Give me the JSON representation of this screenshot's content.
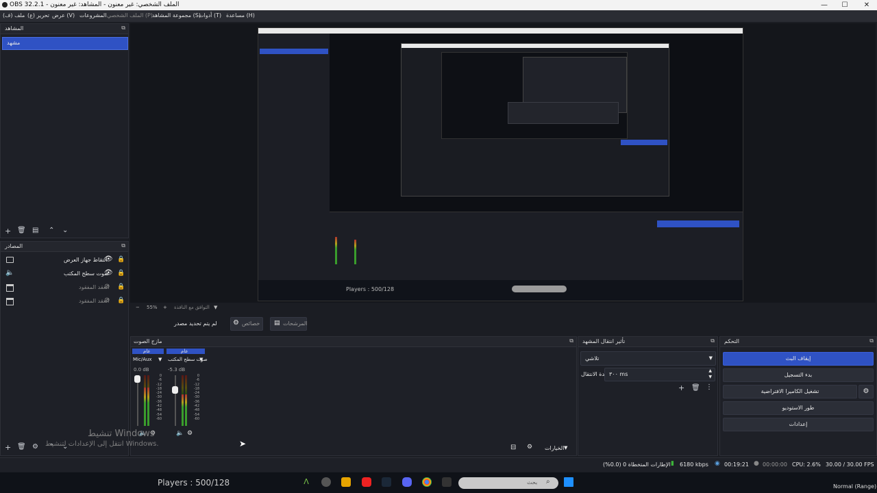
{
  "window": {
    "title": "OBS 32.2.1 - الملف الشخصي: غير معنون - المشاهد: غير معنون",
    "minimize": "—",
    "maximize": "☐",
    "close": "✕"
  },
  "menu": [
    "ملف (ف)",
    "تحرير (ع)",
    "عرض (V)",
    "الملف الشخصي (P)",
    "مجموعة المشاهد (S)",
    "أدوات (T)",
    "مساعدة (H)"
  ],
  "menu_extra": "المشروعات",
  "scenes": {
    "title": "المشاهد",
    "items": [
      "مشهد"
    ]
  },
  "sources": {
    "title": "المصادر",
    "items": [
      {
        "label": "التقاط جهاز العرض",
        "icon": "display-icon"
      },
      {
        "label": "صوت سطح المكتب",
        "icon": "speaker-icon"
      },
      {
        "label": "العقد المفقود",
        "icon": "window-icon"
      },
      {
        "label": "العقد المفقود",
        "icon": "window-icon"
      }
    ]
  },
  "preview": {
    "zoom": "55%",
    "scale_label": "التوافق مع النافذة",
    "nested_players": "Players : 500/128"
  },
  "context_bar": {
    "no_source": "لم يتم تحديد مصدر",
    "properties": "خصائص",
    "filters": "المرشحات"
  },
  "audio_mixer": {
    "title": "مازج الصوت",
    "channels": [
      {
        "name": "Mic/Aux",
        "db": "0.0 dB",
        "tag": "عام",
        "level": 0.75
      },
      {
        "name": "صوت سطح المكتب",
        "db": "-5.3 dB",
        "tag": "عام",
        "level": 0.6
      }
    ],
    "scale": [
      "0",
      "-6",
      "-12",
      "-18",
      "-24",
      "-30",
      "-36",
      "-42",
      "-48",
      "-54",
      "-60"
    ]
  },
  "transitions": {
    "title": "تأثير انتقال المشهد",
    "selected": "تلاشي",
    "duration_label": "مدة الانتقال",
    "duration_value": "٣٠٠ ms"
  },
  "controls": {
    "title": "التحكم",
    "stop_stream": "إيقاف البث",
    "start_recording": "بدء التسجيل",
    "virtual_camera": "تشغيل الكاميرا الافتراضية",
    "studio_mode": "طور الاستوديو",
    "settings": "إعدادات"
  },
  "dock_options": "الخيارات",
  "status_bar": {
    "dropped": "الإطارات المتخطاة 0 (0.0%)",
    "bitrate": "6180 kbps",
    "stream_time": "00:19:21",
    "rec_time": "00:00:00",
    "cpu": "CPU: 2.6%",
    "fps": "30.00 / 30.00 FPS"
  },
  "watermark": {
    "line1": "تنشيط Windows",
    "line2": "انتقل إلى الإعدادات لتنشيط Windows."
  },
  "taskbar": {
    "players": "Players : 500/128",
    "search_placeholder": "بحث",
    "mode": "Normal (Range)"
  },
  "colors": {
    "accent": "#2f52c4",
    "panel": "#1e2027",
    "background": "#1b1d23"
  }
}
